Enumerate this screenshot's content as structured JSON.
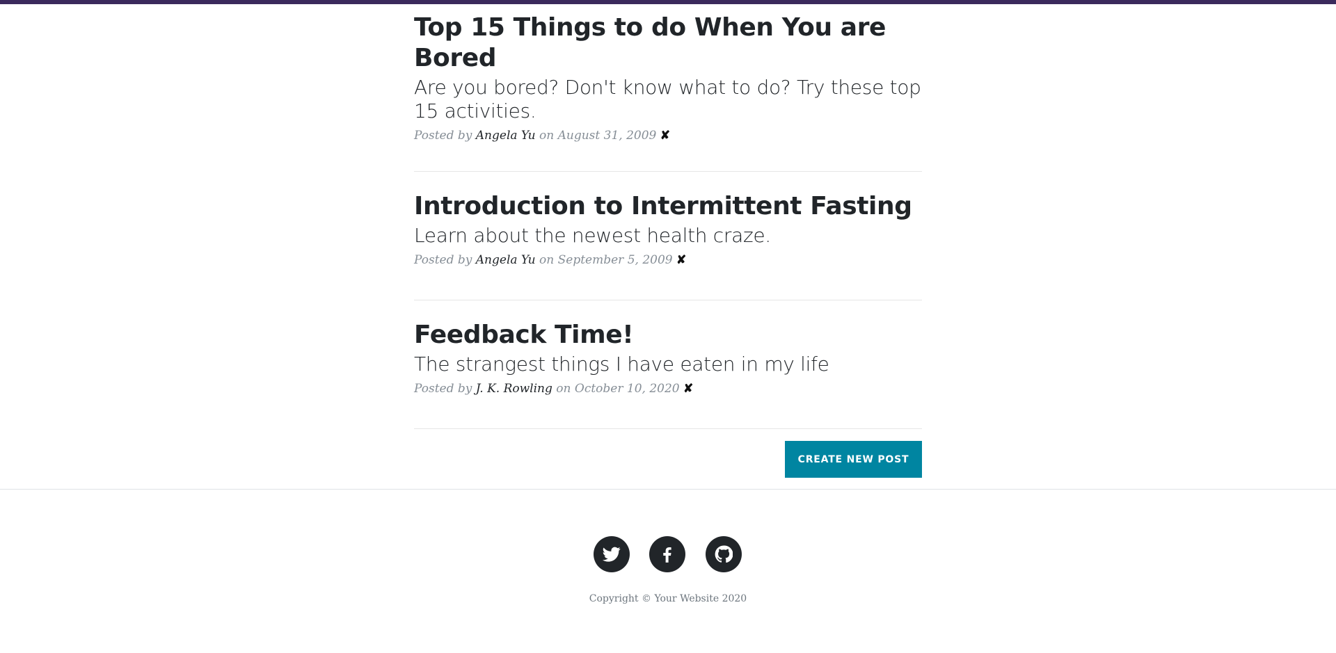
{
  "colors": {
    "top_bar": "#3b2a5c",
    "button_bg": "#0085a1",
    "social_bg": "#212529"
  },
  "posts": [
    {
      "title": "Top 15 Things to do When You are Bored",
      "subtitle": "Are you bored? Don't know what to do? Try these top 15 activities.",
      "meta_prefix": "Posted by",
      "author": "Angela Yu",
      "meta_on": "on",
      "date": "August 31, 2009",
      "delete_glyph": "✘"
    },
    {
      "title": "Introduction to Intermittent Fasting",
      "subtitle": "Learn about the newest health craze.",
      "meta_prefix": "Posted by",
      "author": "Angela Yu",
      "meta_on": "on",
      "date": "September 5, 2009",
      "delete_glyph": "✘"
    },
    {
      "title": "Feedback Time!",
      "subtitle": "The strangest things I have eaten in my life",
      "meta_prefix": "Posted by",
      "author": "J. K. Rowling",
      "meta_on": "on",
      "date": "October 10, 2020",
      "delete_glyph": "✘"
    }
  ],
  "create_button": {
    "label": "CREATE NEW POST"
  },
  "footer": {
    "social_icons": [
      "twitter-icon",
      "facebook-icon",
      "github-icon"
    ],
    "copyright": "Copyright © Your Website 2020"
  }
}
